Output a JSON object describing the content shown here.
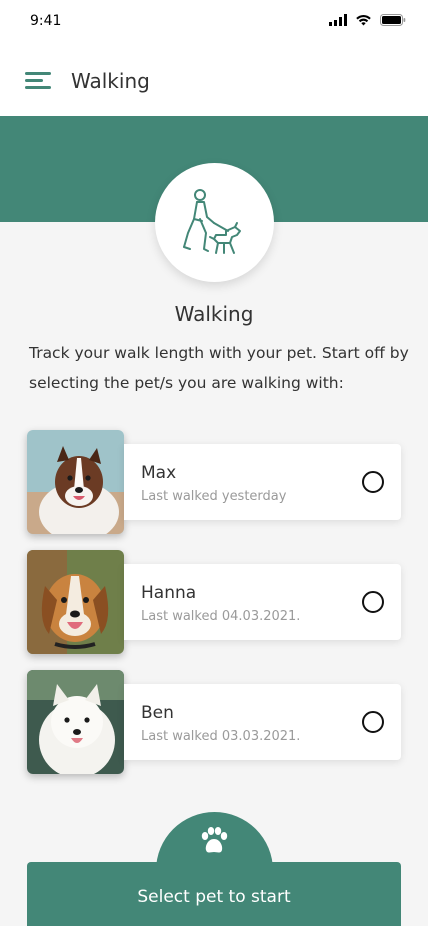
{
  "status_bar": {
    "time": "9:41"
  },
  "app_bar": {
    "title": "Walking"
  },
  "section": {
    "title": "Walking",
    "intro": "Track your walk length with your pet. Start off by selecting the pet/s you are walking with:"
  },
  "pets": [
    {
      "name": "Max",
      "last_walked": "Last walked yesterday",
      "selected": false
    },
    {
      "name": "Hanna",
      "last_walked": "Last walked 04.03.2021.",
      "selected": false
    },
    {
      "name": "Ben",
      "last_walked": "Last walked 03.03.2021.",
      "selected": false
    }
  ],
  "start_button": {
    "label": "Select pet to start"
  },
  "colors": {
    "accent": "#438777",
    "background": "#f5f5f5"
  },
  "icons": {
    "menu": "hamburger-menu-icon",
    "hero": "person-walking-dog-icon",
    "button": "paw-icon"
  }
}
